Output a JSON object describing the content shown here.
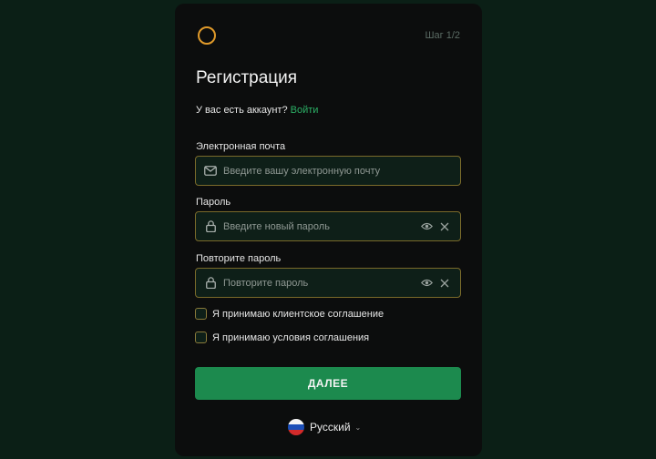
{
  "header": {
    "step": "Шаг 1/2",
    "title": "Регистрация"
  },
  "account": {
    "question": "У вас есть аккаунт?",
    "login_link": "Войти"
  },
  "form": {
    "email": {
      "label": "Электронная почта",
      "placeholder": "Введите вашу электронную почту",
      "icon": "mail-icon"
    },
    "password": {
      "label": "Пароль",
      "placeholder": "Введите новый пароль",
      "icon": "lock-icon"
    },
    "repeat_password": {
      "label": "Повторите пароль",
      "placeholder": "Повторите пароль",
      "icon": "lock-icon"
    }
  },
  "checkboxes": [
    {
      "label": "Я принимаю клиентское соглашение",
      "checked": false
    },
    {
      "label": "Я принимаю условия соглашения",
      "checked": false
    }
  ],
  "submit_label": "ДАЛЕЕ",
  "language": {
    "name": "Русский",
    "flag": "russia-flag-icon"
  },
  "colors": {
    "background": "#0b1f16",
    "card": "#0c0d0d",
    "accent": "#1c8a4e",
    "link": "#2cb066",
    "logo": "#e09a2a",
    "field_border": "#7a6a2a"
  }
}
